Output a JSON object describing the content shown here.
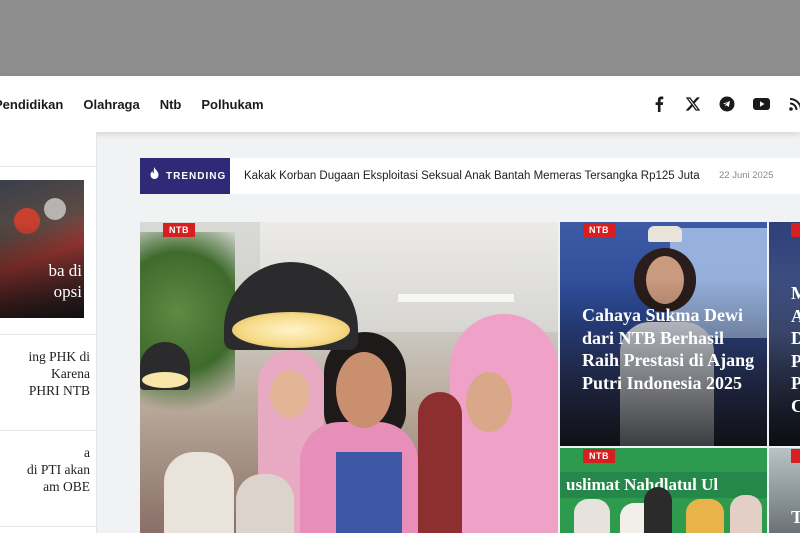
{
  "nav": {
    "items": [
      "Pendidikan",
      "Olahraga",
      "Ntb",
      "Polhukam"
    ],
    "social_icons": [
      "facebook-icon",
      "x-twitter-icon",
      "telegram-icon",
      "youtube-icon",
      "rss-icon"
    ]
  },
  "sidebar": {
    "featured_title": "ba di\nopsi",
    "items": [
      "ing PHK di\nKarena\nPHRI NTB",
      "a\ndi PTI akan\nam OBE"
    ]
  },
  "trending": {
    "label": "TRENDING",
    "headline": "Kakak Korban Dugaan Eksploitasi Seksual Anak Bantah Memeras Tersangka Rp125 Juta",
    "date": "22 Juni 2025"
  },
  "cards": {
    "main": {
      "tag": "NTB"
    },
    "right_top": {
      "tag": "NTB",
      "title": "Cahaya Sukma Dewi dari NTB Berhasil Raih Prestasi di Ajang Putri Indonesia 2025"
    },
    "far_right_top": {
      "tag": "",
      "title": "M\nA\nD\nP\nP\nC"
    },
    "right_bottom": {
      "tag": "NTB",
      "banner": "uslimat Nahdlatul Ul"
    },
    "far_right_bottom": {
      "tag": "",
      "title": "T"
    }
  },
  "colors": {
    "trending_badge": "#2f2a78",
    "tag_red": "#d71f20",
    "nav_bg": "#ffffff",
    "top_bar": "#8e8e8e"
  }
}
